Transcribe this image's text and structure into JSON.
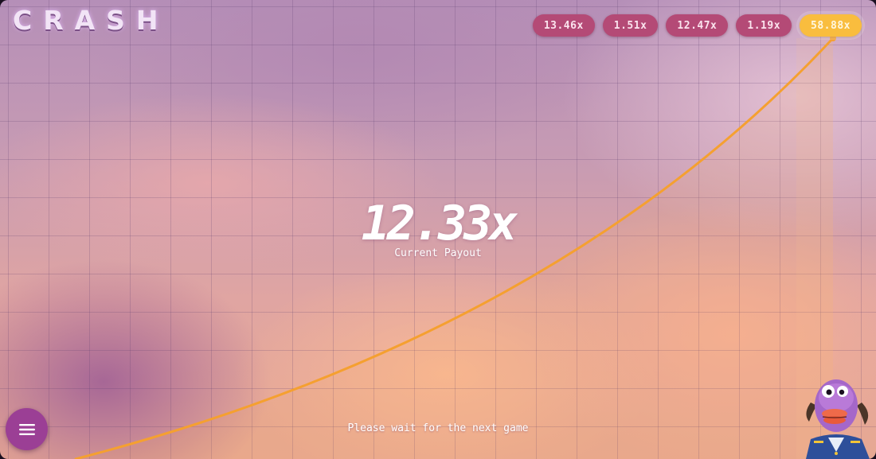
{
  "game": {
    "logo": "CRASH",
    "current_multiplier": "12.33x",
    "current_label": "Current Payout",
    "status_message": "Please wait for the next game"
  },
  "history": [
    {
      "value": "13.46x",
      "highlight": false
    },
    {
      "value": "1.51x",
      "highlight": false
    },
    {
      "value": "12.47x",
      "highlight": false
    },
    {
      "value": "1.19x",
      "highlight": false
    },
    {
      "value": "58.88x",
      "highlight": true
    }
  ],
  "menu": {
    "icon": "hamburger-menu-icon"
  },
  "colors": {
    "curve": "#f5a030",
    "pill": "#b44a76",
    "pill_highlight": "#f9bd3e",
    "menu_button": "#9b3f95"
  }
}
